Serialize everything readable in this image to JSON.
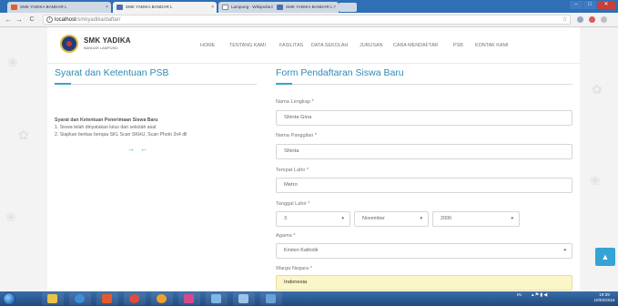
{
  "browser": {
    "tabs": [
      {
        "label": "SMK YADIKA BANDAR L",
        "active": false,
        "favicon_color": "#e0612c"
      },
      {
        "label": "SMK YADIKA BANDAR L",
        "active": true,
        "favicon_color": "#4a6fb0"
      },
      {
        "label": "Lampung - Wikipedia bh",
        "active": false,
        "favicon_color": "#ffffff"
      },
      {
        "label": "SMK YADIKA BANDAR L",
        "active": false,
        "favicon_color": "#4a6fb0"
      }
    ],
    "tab_close_glyph": "×",
    "url_host": "localhost",
    "url_path": "/smkyadika/daftar/",
    "nav_back": "←",
    "nav_forward": "→",
    "nav_reload": "C",
    "url_info_glyph": "i",
    "bookmark_glyph": "☆",
    "win_controls": [
      "–",
      "□",
      "✕"
    ]
  },
  "site": {
    "brand_name": "SMK YADIKA",
    "brand_sub": "BANDAR LAMPUNG",
    "menu": [
      "HOME",
      "TENTANG KAMI",
      "FASILITAS",
      "DATA SEKOLAH",
      "JURUSAN",
      "CARA MENDAFTAR",
      "PSB",
      "KONTAK KAMI"
    ]
  },
  "left_panel": {
    "title": "Syarat dan Ketentuan PSB",
    "heading": "Syarat dan Ketentuan Penerimaan Siswa Baru",
    "lines": [
      "1. Siswa telah dinyatakan lulus dari sekolah asal",
      "2. Siapkan berkas berupa SKL Scan SKHU, Scan Photo 3x4 dll"
    ],
    "arrows": "→ ←"
  },
  "form": {
    "title": "Form Pendaftaran Siswa Baru",
    "required_mark": "*",
    "nama_lengkap": {
      "label": "Nama Lengkap",
      "value": "Shinta Gina"
    },
    "nama_panggilan": {
      "label": "Nama Panggilan",
      "value": "Shinta"
    },
    "tempat_lahir": {
      "label": "Tempat Lahir",
      "value": "Metro"
    },
    "tanggal_lahir": {
      "label": "Tanggal Lahir",
      "day": "3",
      "month": "November",
      "year": "2000"
    },
    "agama": {
      "label": "Agama",
      "value": "Kristen Katholik"
    },
    "warga_negara": {
      "label": "Warga Negara",
      "value": "Indonesia"
    },
    "caret": "▾"
  },
  "scroll_top_glyph": "▲",
  "taskbar": {
    "tray_lang": "IN",
    "tray_icons": "▴ ⚑ ▮ ◀",
    "time": "19:39",
    "date": "10/02/2016"
  }
}
